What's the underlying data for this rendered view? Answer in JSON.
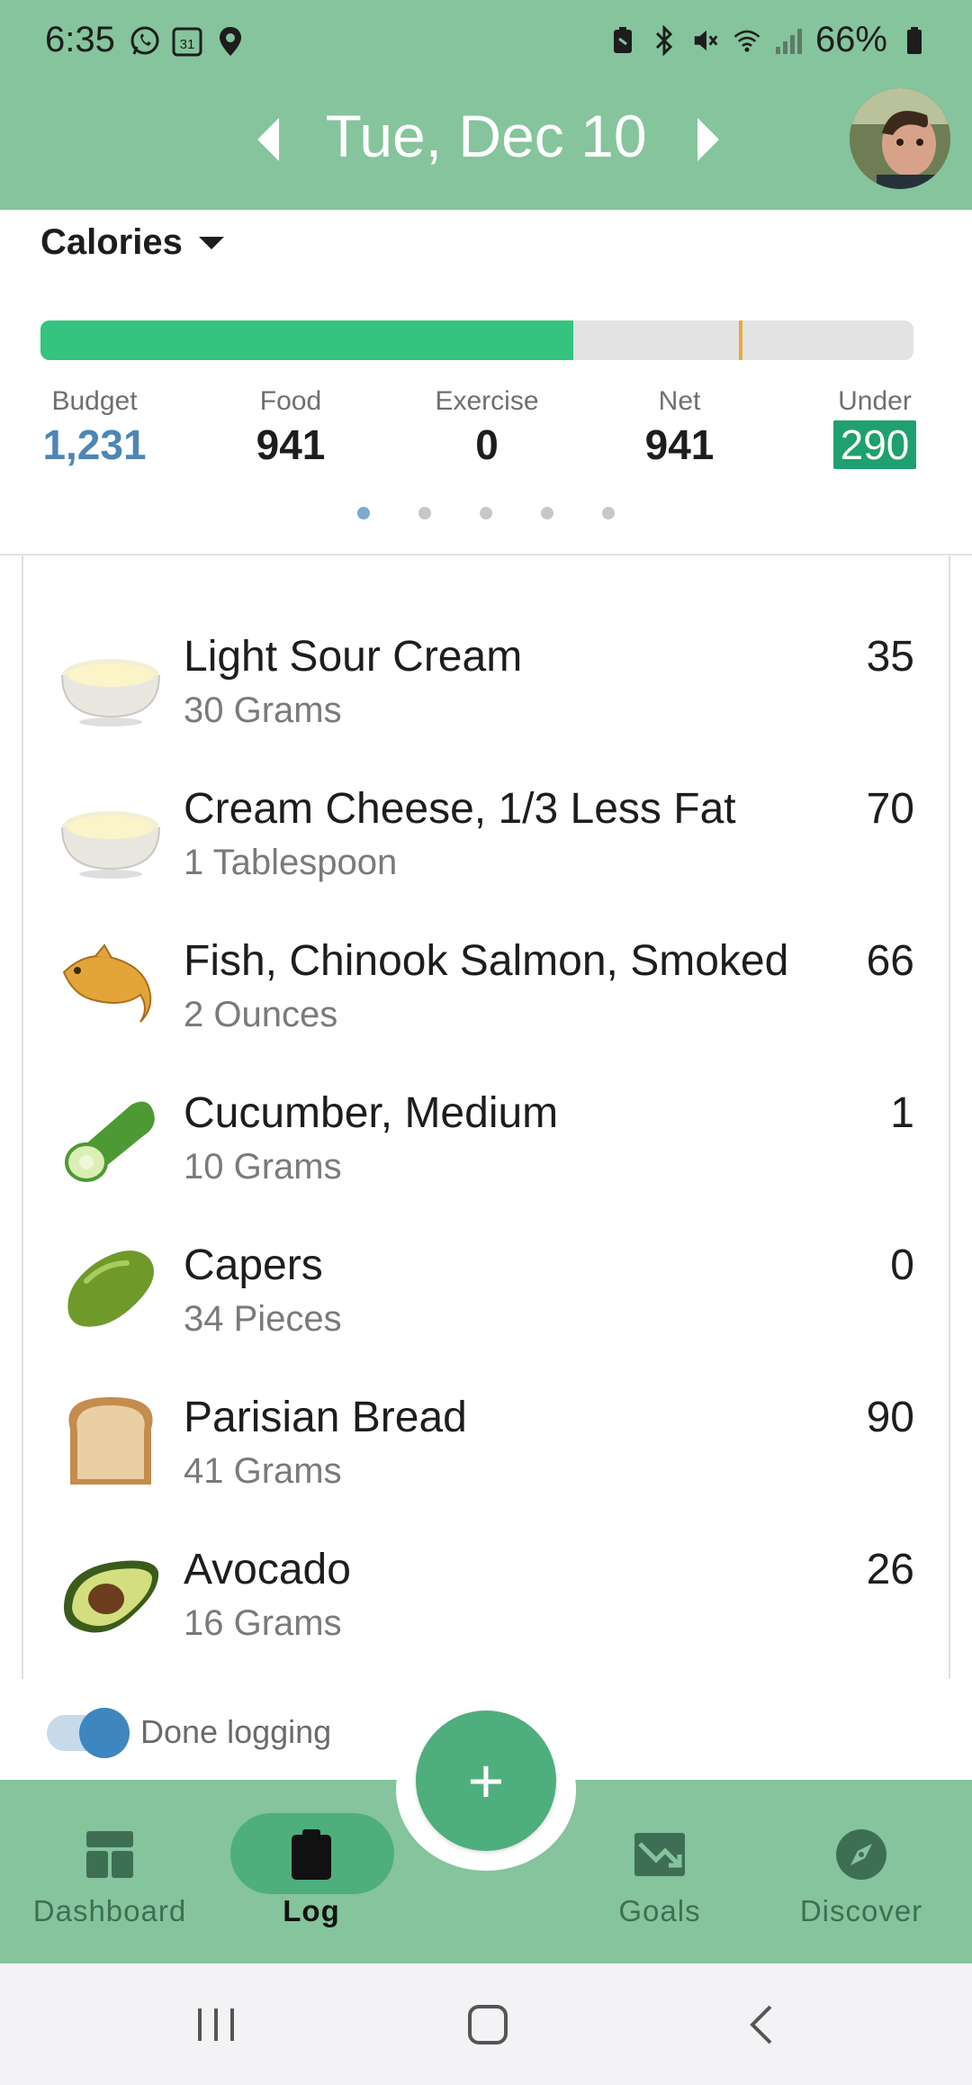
{
  "status_bar": {
    "time": "6:35",
    "battery": "66%",
    "left_icons": [
      "whatsapp-icon",
      "calendar-icon",
      "location-icon"
    ],
    "right_icons": [
      "nfc-icon",
      "bluetooth-icon",
      "mute-icon",
      "wifi-icon",
      "signal-icon",
      "battery-icon"
    ]
  },
  "header": {
    "date": "Tue, Dec 10",
    "background": "#85c49c"
  },
  "calories": {
    "selector_label": "Calories",
    "progress_fraction": 0.61,
    "target_marker_fraction": 0.8,
    "stats": {
      "budget": {
        "label": "Budget",
        "value": "1,231"
      },
      "food": {
        "label": "Food",
        "value": "941"
      },
      "exercise": {
        "label": "Exercise",
        "value": "0"
      },
      "net": {
        "label": "Net",
        "value": "941"
      },
      "under": {
        "label": "Under",
        "value": "290"
      }
    },
    "page_dots": 5,
    "active_dot": 0,
    "colors": {
      "progress": "#34c47f",
      "budget": "#4d86b5",
      "under_badge": "#1fa070",
      "marker": "#e8a93a"
    }
  },
  "foods": [
    {
      "name": "Light Sour Cream",
      "serving": "30 Grams",
      "calories": "35",
      "icon": "sour-cream-icon"
    },
    {
      "name": "Cream Cheese, 1/3 Less Fat",
      "serving": "1 Tablespoon",
      "calories": "70",
      "icon": "cream-cheese-icon"
    },
    {
      "name": "Fish, Chinook Salmon, Smoked",
      "serving": "2 Ounces",
      "calories": "66",
      "icon": "fish-icon"
    },
    {
      "name": "Cucumber, Medium",
      "serving": "10 Grams",
      "calories": "1",
      "icon": "cucumber-icon"
    },
    {
      "name": "Capers",
      "serving": "34 Pieces",
      "calories": "0",
      "icon": "capers-icon"
    },
    {
      "name": "Parisian Bread",
      "serving": "41 Grams",
      "calories": "90",
      "icon": "bread-icon"
    },
    {
      "name": "Avocado",
      "serving": "16 Grams",
      "calories": "26",
      "icon": "avocado-icon"
    }
  ],
  "done_logging": {
    "label": "Done logging",
    "on": true
  },
  "fab": {
    "label": "+"
  },
  "nav": {
    "dashboard": "Dashboard",
    "log": "Log",
    "goals": "Goals",
    "discover": "Discover",
    "active": "log"
  }
}
